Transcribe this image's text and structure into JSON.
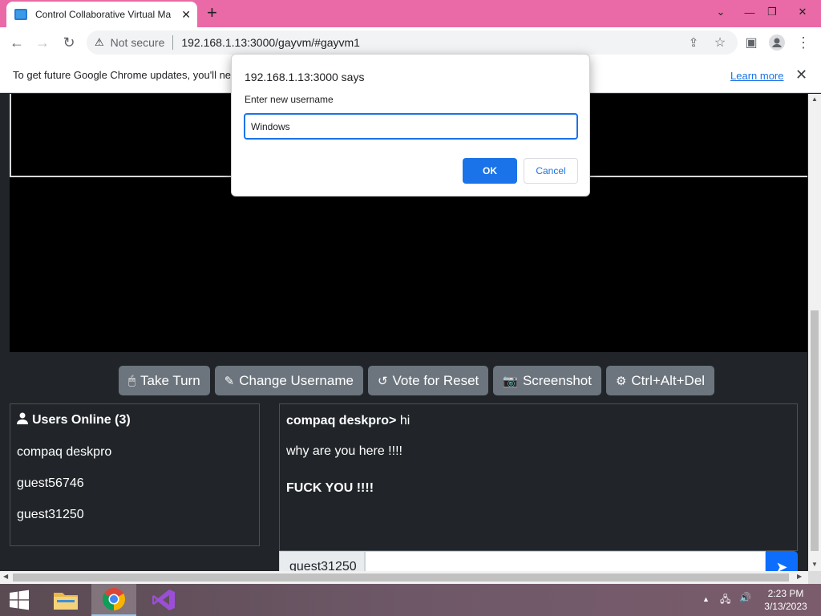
{
  "browser": {
    "tab_title": "Control Collaborative Virtual Ma",
    "url_prefix": "192.168.1.13",
    "url": "192.168.1.13:3000/gayvm/#gayvm1",
    "security_label": "Not secure",
    "infobar_text": "To get future Google Chrome updates, you'll ne",
    "infobar_link": "Learn more"
  },
  "dialog": {
    "title": "192.168.1.13:3000 says",
    "prompt": "Enter new username",
    "input_value": "Windows",
    "ok_label": "OK",
    "cancel_label": "Cancel"
  },
  "vm_controls": {
    "take_turn": "Take Turn",
    "change_username": "Change Username",
    "vote_reset": "Vote for Reset",
    "screenshot": "Screenshot",
    "ctrl_alt_del": "Ctrl+Alt+Del"
  },
  "users_panel": {
    "title": "Users Online (3)",
    "users": [
      "compaq deskpro",
      "guest56746",
      "guest31250"
    ]
  },
  "chat": {
    "messages": [
      {
        "sender": "compaq deskpro>",
        "text": " hi"
      },
      {
        "sender": "",
        "text": "why are you here !!!!"
      },
      {
        "sender": "",
        "text": "FUCK YOU !!!!"
      }
    ],
    "username": "guest31250"
  },
  "taskbar": {
    "time": "2:23 PM",
    "date": "3/13/2023"
  }
}
